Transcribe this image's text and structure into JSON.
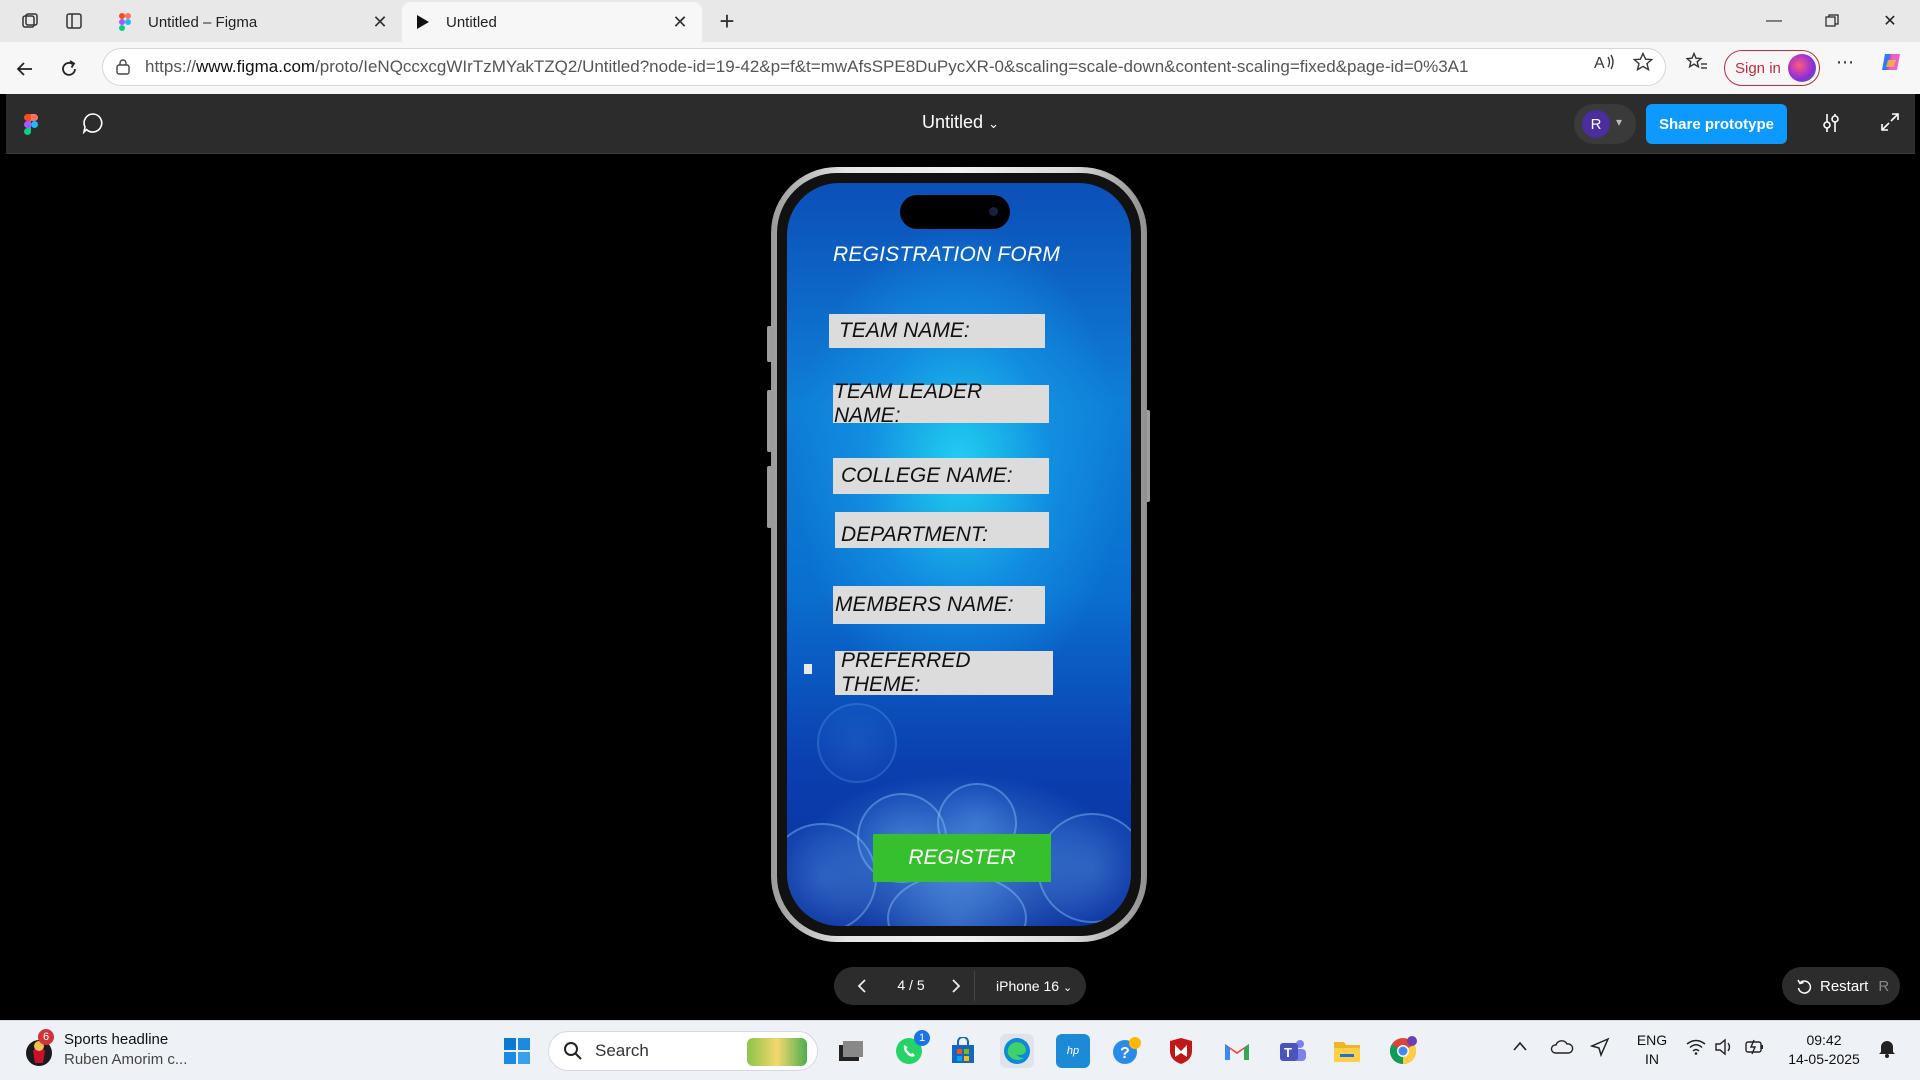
{
  "browser": {
    "tabs": [
      {
        "title": "Untitled – Figma",
        "icon": "figma-icon",
        "active": false
      },
      {
        "title": "Untitled",
        "icon": "play-icon",
        "active": true
      }
    ],
    "url_prefix": "https://",
    "url_domain": "www.figma.com",
    "url_path": "/proto/IeNQccxcgWIrTzMYakTZQ2/Untitled?node-id=19-42&p=f&t=mwAfsSPE8DuPycXR-0&scaling=scale-down&content-scaling=fixed&page-id=0%3A1",
    "sign_in_label": "Sign in",
    "accent_color": "#c42b3d"
  },
  "figma": {
    "file_title": "Untitled",
    "user_initial": "R",
    "share_label": "Share prototype",
    "share_color": "#0d99ff"
  },
  "prototype": {
    "form_title": "REGISTRATION FORM",
    "fields": [
      "TEAM NAME:",
      "TEAM LEADER NAME:",
      "COLLEGE NAME:",
      "DEPARTMENT:",
      "MEMBERS NAME:",
      "PREFERRED THEME:"
    ],
    "register_label": "REGISTER",
    "register_color": "#36c02d"
  },
  "controls": {
    "page_counter": "4 / 5",
    "device_label": "iPhone 16",
    "restart_label": "Restart",
    "restart_key": "R"
  },
  "taskbar": {
    "news_title": "Sports headline",
    "news_subtitle": "Ruben Amorim c...",
    "news_badge": "6",
    "search_label": "Search",
    "whatsapp_badge": "1",
    "lang_top": "ENG",
    "lang_bottom": "IN",
    "time": "09:42",
    "date": "14-05-2025"
  }
}
